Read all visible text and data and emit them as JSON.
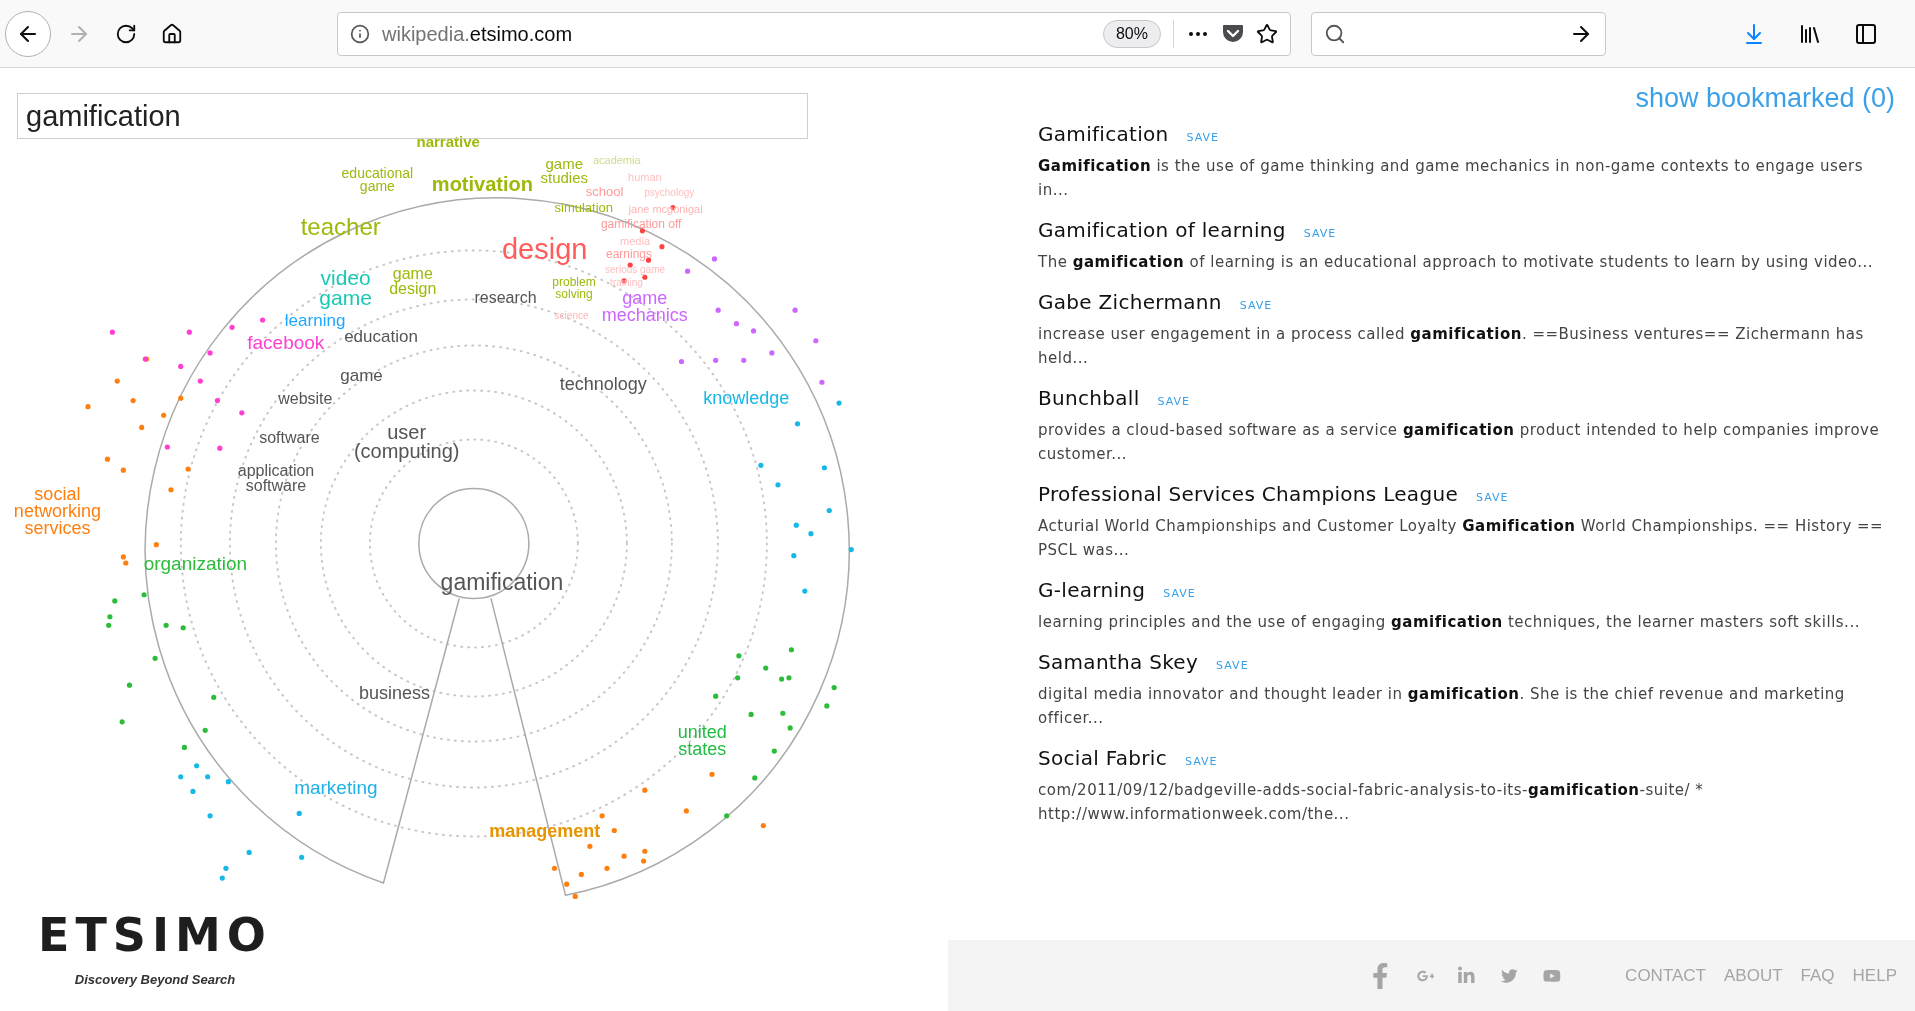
{
  "browser": {
    "forward_disabled": true,
    "url": {
      "subdomain": "wikipedia.",
      "domain": "etsimo.com"
    },
    "zoom": "80%"
  },
  "search": {
    "value": "gamification"
  },
  "graph": {
    "words": [
      {
        "text": "narrative",
        "color": "#9fb80a"
      },
      {
        "text": "educational game",
        "color": "#9fb80a"
      },
      {
        "text": "motivation",
        "color": "#9fb80a"
      },
      {
        "text": "game studies",
        "color": "#9fb80a"
      },
      {
        "text": "academia",
        "color": "#cfdc8c"
      },
      {
        "text": "human",
        "color": "#ffc0c0"
      },
      {
        "text": "school",
        "color": "#ff9a9a"
      },
      {
        "text": "psychology",
        "color": "#ffc0c0"
      },
      {
        "text": "simulation",
        "color": "#9fb80a"
      },
      {
        "text": "jane mcgonigal",
        "color": "#ffb4b4"
      },
      {
        "text": "teacher",
        "color": "#9fb80a"
      },
      {
        "text": "gamification off",
        "color": "#ff9a9a"
      },
      {
        "text": "media",
        "color": "#ffc0c0"
      },
      {
        "text": "design",
        "color": "#ff5c5c"
      },
      {
        "text": "earnings",
        "color": "#ff9a9a"
      },
      {
        "text": "video game",
        "color": "#19c9b3"
      },
      {
        "text": "game design",
        "color": "#9fb80a"
      },
      {
        "text": "research",
        "color": "#555555"
      },
      {
        "text": "problem solving",
        "color": "#9fb80a"
      },
      {
        "text": "serious game",
        "color": "#ffc0c0"
      },
      {
        "text": "training",
        "color": "#ffc0c0"
      },
      {
        "text": "learning",
        "color": "#1ea7ff"
      },
      {
        "text": "science",
        "color": "#ffb4b4"
      },
      {
        "text": "game mechanics",
        "color": "#cc66ff"
      },
      {
        "text": "education",
        "color": "#555555"
      },
      {
        "text": "facebook",
        "color": "#ff3fd0"
      },
      {
        "text": "game",
        "color": "#555555"
      },
      {
        "text": "technology",
        "color": "#555555"
      },
      {
        "text": "website",
        "color": "#555555"
      },
      {
        "text": "knowledge",
        "color": "#16b8e6"
      },
      {
        "text": "software",
        "color": "#555555"
      },
      {
        "text": "user (computing)",
        "color": "#555555"
      },
      {
        "text": "application software",
        "color": "#555555"
      },
      {
        "text": "social networking services",
        "color": "#ff7f0e"
      },
      {
        "text": "organization",
        "color": "#2dbb3a"
      },
      {
        "text": "gamification",
        "color": "#555555"
      },
      {
        "text": "business",
        "color": "#555555"
      },
      {
        "text": "united states",
        "color": "#22bb44"
      },
      {
        "text": "marketing",
        "color": "#1fb2e8"
      },
      {
        "text": "management",
        "color": "#e69500"
      }
    ]
  },
  "logo": {
    "name": "ETSIMO",
    "tagline": "Discovery Beyond Search"
  },
  "bookmarked": "show bookmarked (0)",
  "results": [
    {
      "title": "Gamification",
      "save": "SAVE",
      "snippet": "**Gamification** is the use of game thinking and game mechanics in non-game contexts to engage users in..."
    },
    {
      "title": "Gamification of learning",
      "save": "SAVE",
      "snippet": "The **gamification** of learning is an educational approach to motivate students to learn by using video..."
    },
    {
      "title": "Gabe Zichermann",
      "save": "SAVE",
      "snippet": "increase user engagement in a process called **gamification**. ==Business ventures== Zichermann has held..."
    },
    {
      "title": "Bunchball",
      "save": "SAVE",
      "snippet": "provides a cloud-based software as a service **gamification** product intended to help companies improve customer..."
    },
    {
      "title": "Professional Services Champions League",
      "save": "SAVE",
      "snippet": "Acturial World Championships and Customer Loyalty **Gamification** World Championships. == History == PSCL was..."
    },
    {
      "title": "G-learning",
      "save": "SAVE",
      "snippet": "learning principles and the use of engaging **gamification** techniques, the learner masters soft skills..."
    },
    {
      "title": "Samantha Skey",
      "save": "SAVE",
      "snippet": "digital media innovator and thought leader in **gamification**. She is the chief revenue and marketing officer..."
    },
    {
      "title": "Social Fabric",
      "save": "SAVE",
      "snippet": "com/2011/09/12/badgeville-adds-social-fabric-analysis-to-its-**gamification**-suite/ * http://www.informationweek.com/the..."
    }
  ],
  "footer": {
    "links": [
      "CONTACT",
      "ABOUT",
      "FAQ",
      "HELP"
    ]
  }
}
